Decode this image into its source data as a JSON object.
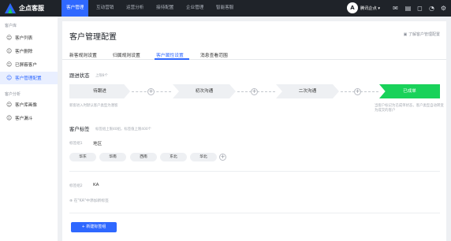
{
  "topbar": {
    "brand": "企点客服",
    "nav": [
      "客户管理",
      "互动营销",
      "运营分析",
      "接待配置",
      "企业管理",
      "智能客服"
    ],
    "avatar_letter": "A",
    "user": "腾讯企点 ▾",
    "icons": [
      "mail-icon",
      "doc-icon",
      "chat-icon",
      "bell-icon",
      "settings-icon"
    ]
  },
  "sidebar": {
    "section1": "客户库",
    "items1": [
      {
        "label": "客户列表",
        "icon": "user-icon"
      },
      {
        "label": "客户删除",
        "icon": "user-minus-icon"
      },
      {
        "label": "已屏蔽客户",
        "icon": "user-block-icon"
      },
      {
        "label": "客户管理配置",
        "icon": "user-config-icon"
      }
    ],
    "section2": "客户分析",
    "items2": [
      {
        "label": "客户库画像",
        "icon": "portrait-icon"
      },
      {
        "label": "客户漏斗",
        "icon": "funnel-icon"
      }
    ]
  },
  "page": {
    "title": "客户管理配置",
    "help": "了解客户管理配置",
    "tabs": [
      "新客规则设置",
      "归属规则设置",
      "客户属性设置",
      "消息查看范围"
    ],
    "active_tab": 2
  },
  "follow": {
    "title": "跟进状态",
    "hint": "上限8个",
    "steps": [
      "待跟进",
      "初次沟通",
      "二次沟通",
      "已成单"
    ],
    "note_left": "新客进入时默认客户类型为潜客",
    "note_right": "当客户标记为已成单状态，客户类型自动转变为成交的客户"
  },
  "tags": {
    "title": "客户标签",
    "hint": "标签组上限40组，标签值上限400个",
    "group1_label": "标签组1",
    "group1_name": "地区",
    "group1_values": [
      "华东",
      "华南",
      "西南",
      "东北",
      "华北"
    ],
    "group2_label": "标签组2",
    "group2_name": "KA",
    "add_tag": "在\"KA\"中添加新标签",
    "new_group_button": "+ 新建标签组"
  }
}
